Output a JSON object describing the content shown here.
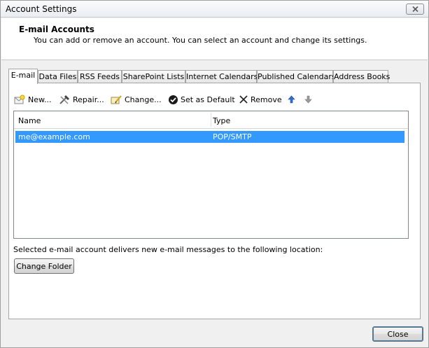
{
  "window": {
    "title": "Account Settings"
  },
  "header": {
    "title": "E-mail Accounts",
    "description": "You can add or remove an account. You can select an account and change its settings."
  },
  "tabs": [
    {
      "label": "E-mail",
      "active": true
    },
    {
      "label": "Data Files",
      "active": false
    },
    {
      "label": "RSS Feeds",
      "active": false
    },
    {
      "label": "SharePoint Lists",
      "active": false
    },
    {
      "label": "Internet Calendars",
      "active": false
    },
    {
      "label": "Published Calendars",
      "active": false
    },
    {
      "label": "Address Books",
      "active": false
    }
  ],
  "toolbar": {
    "new_label": "New...",
    "repair_label": "Repair...",
    "change_label": "Change...",
    "default_label": "Set as Default",
    "remove_label": "Remove",
    "icons": [
      "new-account-icon",
      "repair-icon",
      "change-icon",
      "set-default-check-icon",
      "remove-x-icon",
      "move-up-arrow-icon",
      "move-down-arrow-icon"
    ]
  },
  "accounts_table": {
    "columns": [
      "Name",
      "Type"
    ],
    "rows": [
      {
        "name": "me@example.com",
        "type": "POP/SMTP",
        "selected": true
      }
    ]
  },
  "delivery_note": "Selected e-mail account delivers new e-mail messages to the following location:",
  "buttons": {
    "change_folder": "Change Folder",
    "close": "Close"
  },
  "colors": {
    "selection": "#3399ff",
    "dialog_bg": "#f0f0f0",
    "header_bg": "#ffffff"
  }
}
